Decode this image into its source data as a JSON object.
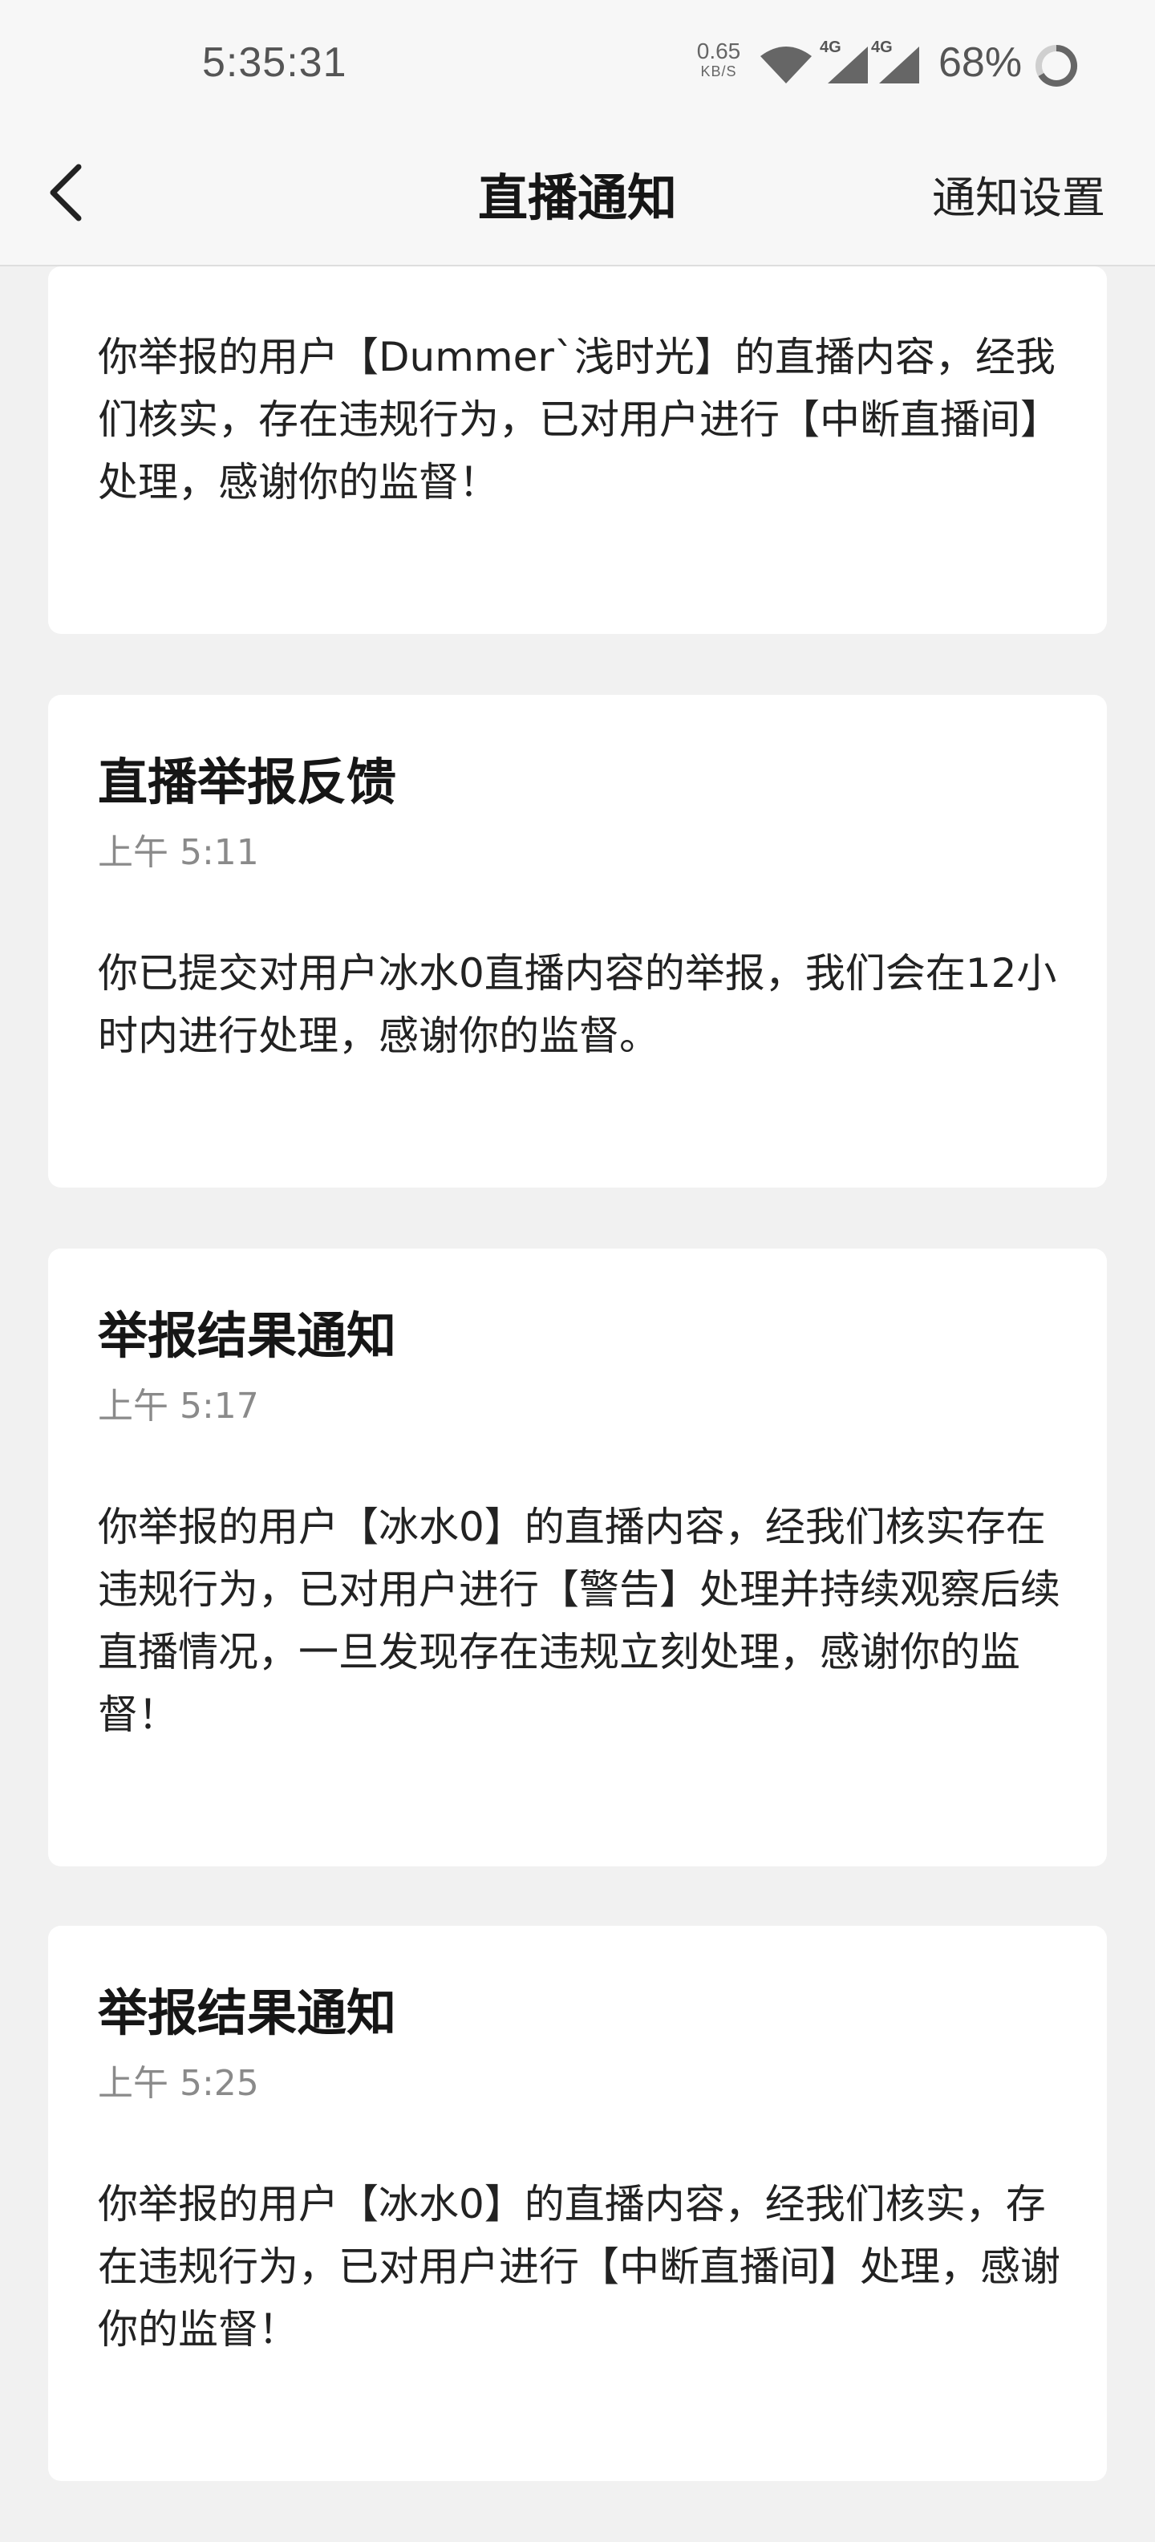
{
  "status_bar": {
    "time": "5:35:31",
    "net_speed_value": "0.65",
    "net_speed_unit": "KB/S",
    "signal1_label": "4G",
    "signal2_label": "4G",
    "battery": "68%"
  },
  "nav": {
    "title": "直播通知",
    "right_label": "通知设置"
  },
  "notifications": [
    {
      "title": "",
      "time": "",
      "body": "你举报的用户【Dummer`浅时光】的直播内容，经我们核实，存在违规行为，已对用户进行【中断直播间】处理，感谢你的监督！"
    },
    {
      "title": "直播举报反馈",
      "time": "上午 5:11",
      "body": "你已提交对用户冰水0直播内容的举报，我们会在12小时内进行处理，感谢你的监督。"
    },
    {
      "title": "举报结果通知",
      "time": "上午 5:17",
      "body": "你举报的用户【冰水0】的直播内容，经我们核实存在违规行为，已对用户进行【警告】处理并持续观察后续直播情况，一旦发现存在违规立刻处理，感谢你的监督！"
    },
    {
      "title": "举报结果通知",
      "time": "上午 5:25",
      "body": "你举报的用户【冰水0】的直播内容，经我们核实，存在违规行为，已对用户进行【中断直播间】处理，感谢你的监督！"
    }
  ]
}
